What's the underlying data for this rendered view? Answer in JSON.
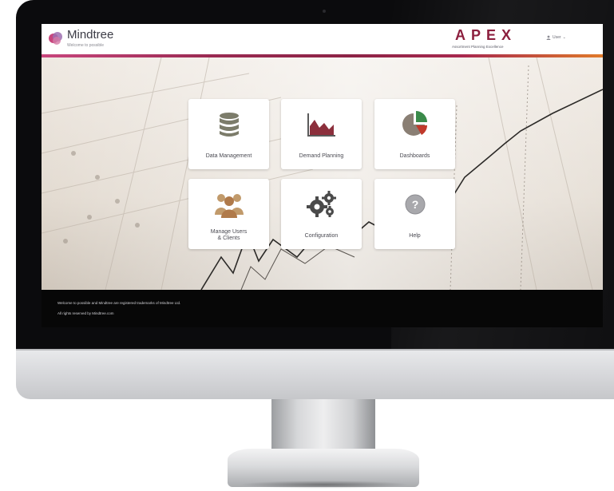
{
  "header": {
    "brand": "Mindtree",
    "brand_tagline": "Welcome to possible",
    "product": "APEX",
    "product_tagline": "Assortment Planning Excellence",
    "user_label": "User"
  },
  "tiles": [
    {
      "label": "Data Management",
      "icon": "database-icon"
    },
    {
      "label": "Demand Planning",
      "icon": "area-chart-icon"
    },
    {
      "label": "Dashboards",
      "icon": "pie-chart-icon"
    },
    {
      "label": "Manage Users & Clients",
      "label_line1": "Manage Users",
      "label_line2": "& Clients",
      "icon": "users-icon"
    },
    {
      "label": "Configuration",
      "icon": "gears-icon"
    },
    {
      "label": "Help",
      "icon": "help-icon"
    }
  ],
  "footer": {
    "line1": "Welcome to possible and Mindtree are registered trademarks of Mindtree Ltd.",
    "line2": "All rights reserved by Mindtree.com"
  },
  "colors": {
    "accent": "#8c1f3e",
    "accent_orange": "#e07a2a",
    "footer_bg": "#070707",
    "pie_green": "#3a8a4a",
    "pie_red": "#c0392b"
  }
}
